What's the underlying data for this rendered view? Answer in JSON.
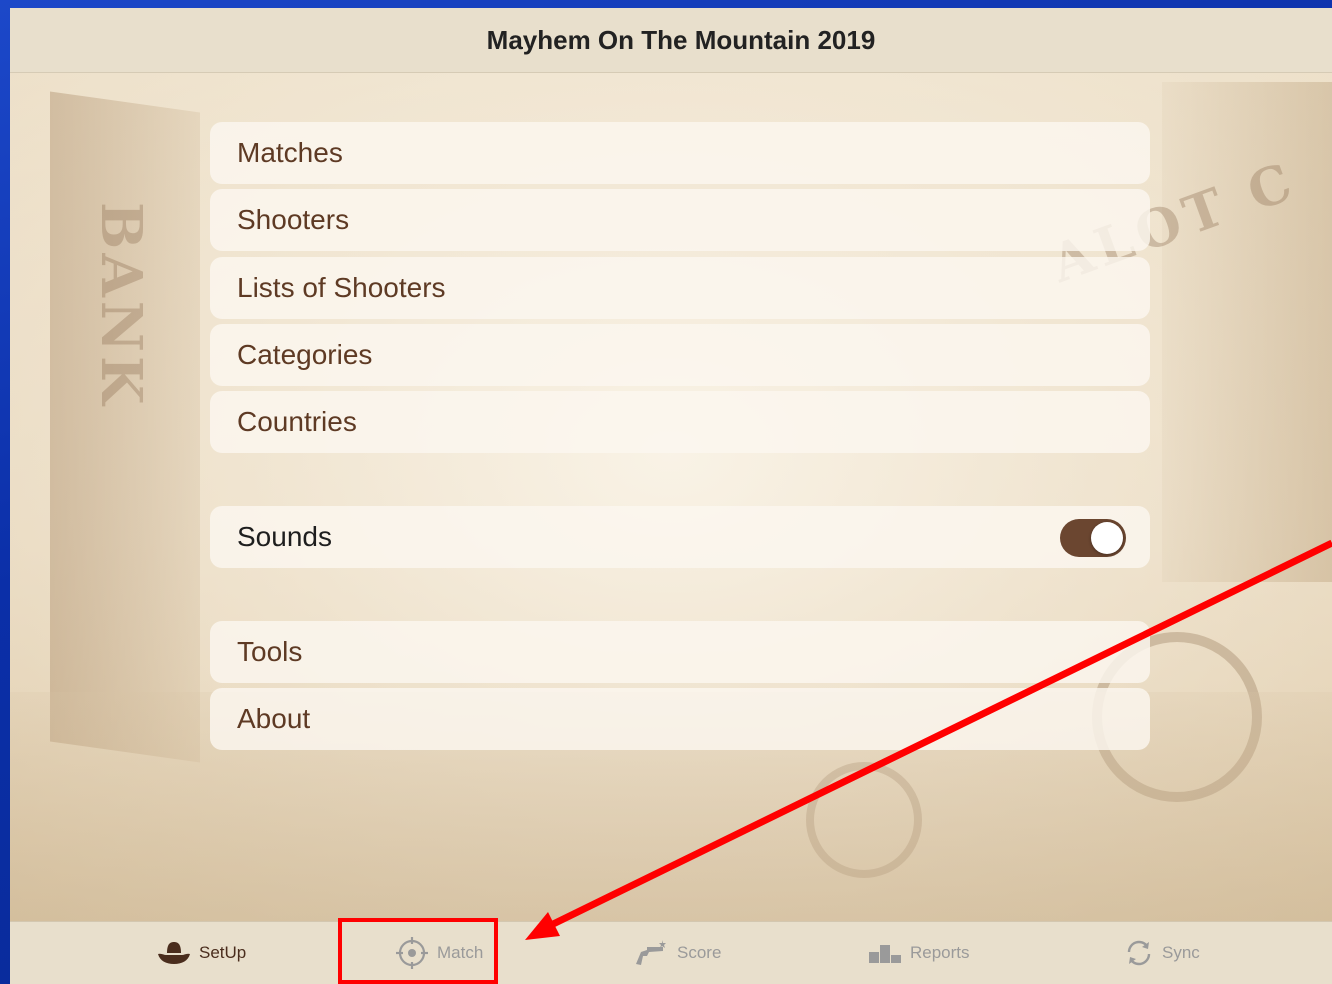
{
  "app": {
    "title": "Mayhem On The Mountain 2019"
  },
  "menu": {
    "group1": [
      "Matches",
      "Shooters",
      "Lists of Shooters",
      "Categories",
      "Countries"
    ],
    "sounds": {
      "label": "Sounds",
      "enabled": true
    },
    "group3": [
      "Tools",
      "About"
    ]
  },
  "tabs": [
    {
      "label": "SetUp",
      "icon": "cowboy-hat-icon",
      "active": true
    },
    {
      "label": "Match",
      "icon": "crosshair-icon",
      "active": false
    },
    {
      "label": "Score",
      "icon": "revolver-icon",
      "active": false
    },
    {
      "label": "Reports",
      "icon": "podium-icon",
      "active": false
    },
    {
      "label": "Sync",
      "icon": "sync-icon",
      "active": false
    }
  ],
  "colors": {
    "accent": "#5e3a24",
    "toggle_on": "#6b4630",
    "annotation": "#ff0000",
    "outer_background": "#0b2fa8"
  }
}
